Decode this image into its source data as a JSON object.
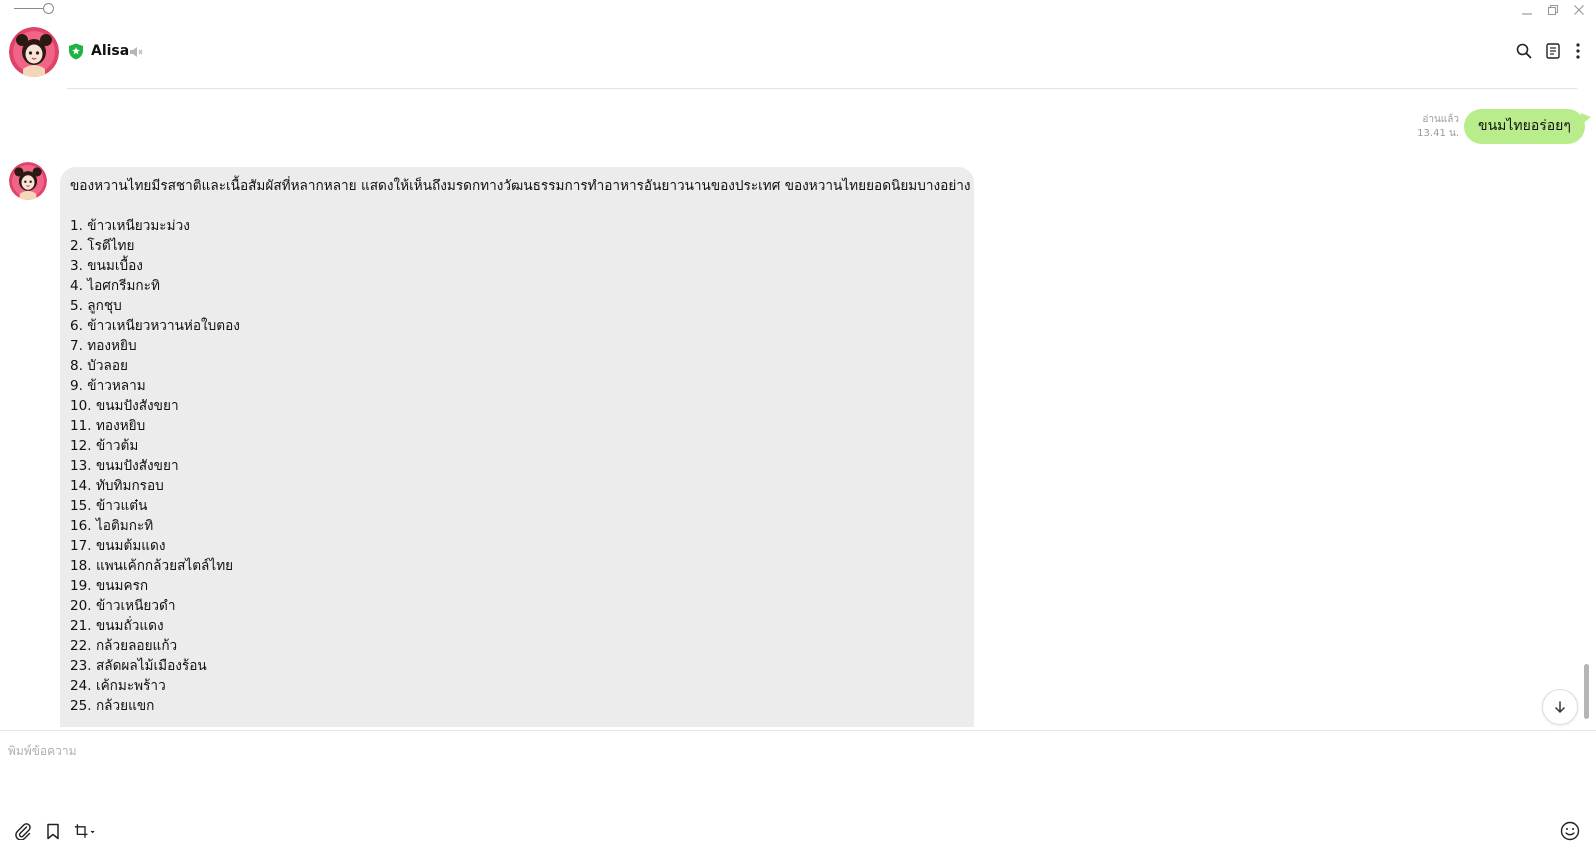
{
  "window": {
    "controls": [
      "minimize-icon",
      "restore-icon",
      "close-icon"
    ]
  },
  "header": {
    "contact_name": "Alisa",
    "icons": [
      "shield-icon",
      "mute-icon",
      "search-icon",
      "notes-icon",
      "more-icon"
    ]
  },
  "messages": {
    "outgoing": {
      "text": "ขนมไทยอร่อยๆ",
      "read_status": "อ่านแล้ว",
      "time": "13.41 น."
    },
    "incoming": {
      "intro": "ของหวานไทยมีรสชาติและเนื้อสัมผัสที่หลากหลาย แสดงให้เห็นถึงมรดกทางวัฒนธรรมการทำอาหารอันยาวนานของประเทศ ของหวานไทยยอดนิยมบางอย่าง ได้แก่:",
      "items": [
        "1. ข้าวเหนียวมะม่วง",
        "2. โรตีไทย",
        "3. ขนมเบื้อง",
        "4. ไอศกรีมกะทิ",
        "5. ลูกชุบ",
        "6. ข้าวเหนียวหวานห่อใบตอง",
        "7. ทองหยิบ",
        "8. บัวลอย",
        "9. ข้าวหลาม",
        "10. ขนมปังสังขยา",
        "11. ทองหยิบ",
        "12. ข้าวต้ม",
        "13. ขนมปังสังขยา",
        "14. ทับทิมกรอบ",
        "15. ข้าวแต๋น",
        "16. ไอติมกะทิ",
        "17. ขนมต้มแดง",
        "18. แพนเค้กกล้วยสไตล์ไทย",
        "19. ขนมครก",
        "20. ข้าวเหนียวดำ",
        "21. ขนมถั่วแดง",
        "22. กล้วยลอยแก้ว",
        "23. สลัดผลไม้เมืองร้อน",
        "24. เค้กมะพร้าว",
        "25. กล้วยแขก"
      ]
    }
  },
  "composer": {
    "placeholder": "พิมพ์ข้อความ",
    "tools": [
      "attach-icon",
      "bookmark-icon",
      "crop-icon",
      "emoji-icon"
    ]
  },
  "colors": {
    "outgoing_bubble": "#b9ed8c",
    "incoming_bubble": "#ececec",
    "verified_badge": "#1db446"
  }
}
